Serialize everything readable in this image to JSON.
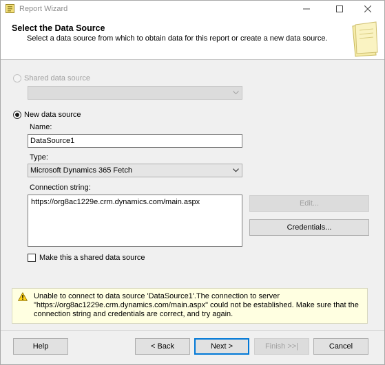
{
  "window": {
    "title": "Report Wizard"
  },
  "header": {
    "title": "Select the Data Source",
    "description": "Select a data source from which to obtain data for this report or create a new data source."
  },
  "shared_source": {
    "label": "Shared data source",
    "selected": false,
    "enabled": false,
    "value": ""
  },
  "new_source": {
    "label": "New data source",
    "selected": true,
    "name_label": "Name:",
    "name_value": "DataSource1",
    "type_label": "Type:",
    "type_value": "Microsoft Dynamics 365 Fetch",
    "conn_label": "Connection string:",
    "conn_value": "https://org8ac1229e.crm.dynamics.com/main.aspx",
    "edit_label": "Edit...",
    "credentials_label": "Credentials...",
    "shared_checkbox_label": "Make this a shared data source",
    "shared_checkbox_checked": false
  },
  "warning": {
    "icon": "warning-icon",
    "line1": "Unable to connect to data source 'DataSource1'.The connection to server",
    "line2": "\"https://org8ac1229e.crm.dynamics.com/main.aspx\" could not be established. Make sure that the",
    "line3": "connection string and credentials are correct, and try again."
  },
  "footer": {
    "help": "Help",
    "back": "< Back",
    "next": "Next >",
    "finish": "Finish >>|",
    "cancel": "Cancel"
  },
  "colors": {
    "accent": "#0078d7",
    "warning_bg": "#ffffe1"
  }
}
